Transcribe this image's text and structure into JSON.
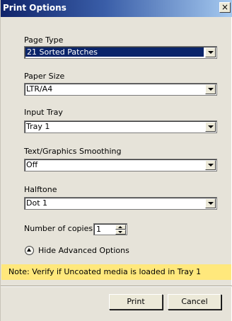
{
  "window": {
    "title": "Print Options",
    "close_glyph": "×"
  },
  "fields": [
    {
      "label": "Page Type",
      "value": "21 Sorted Patches",
      "selected": true
    },
    {
      "label": "Paper Size",
      "value": "LTR/A4"
    },
    {
      "label": "Input Tray",
      "value": "Tray 1"
    },
    {
      "label": "Text/Graphics Smoothing",
      "value": "Off"
    },
    {
      "label": "Halftone",
      "value": "Dot 1"
    }
  ],
  "copies": {
    "label": "Number of copies:",
    "value": "1"
  },
  "advanced": {
    "label": "Hide Advanced Options",
    "icon": "collapse-up-icon"
  },
  "note": {
    "text": "Note: Verify if Uncoated media is loaded in Tray 1",
    "color": "#ffe87c"
  },
  "buttons": {
    "print": "Print",
    "cancel": "Cancel"
  },
  "colors": {
    "titlebar_start": "#10246a",
    "titlebar_end": "#a6caf0",
    "selection": "#0a246a",
    "dialog_bg": "#e6e3d9"
  }
}
